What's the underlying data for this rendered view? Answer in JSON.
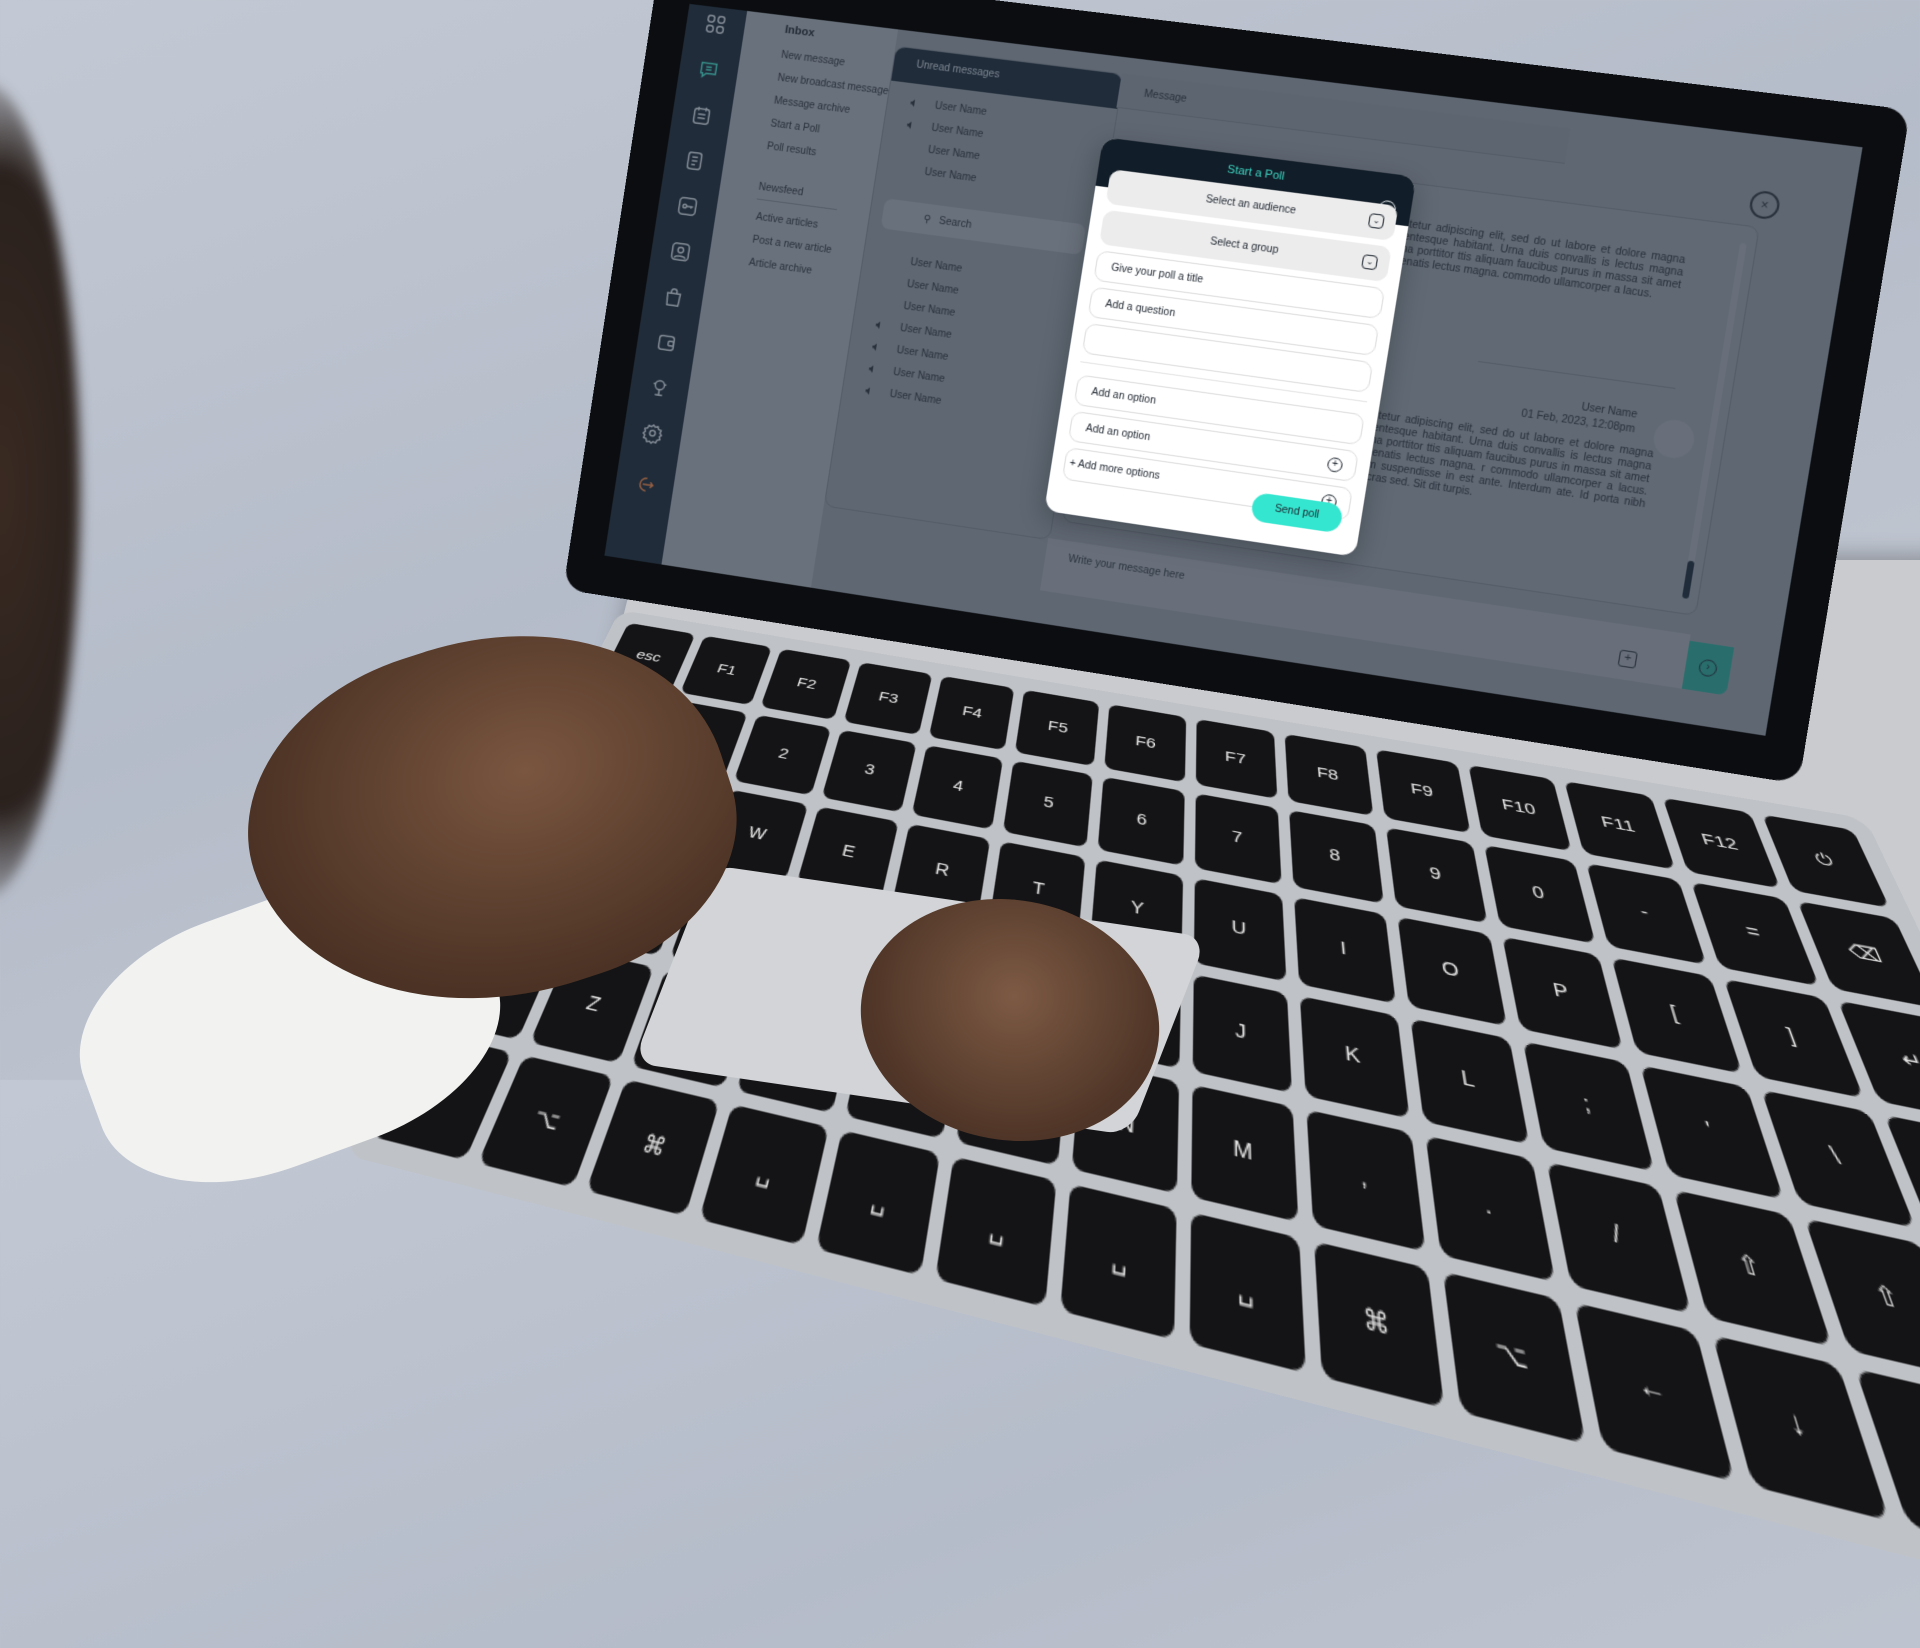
{
  "colors": {
    "rail_bg": "#1d2a3a",
    "accent_teal": "#3ec4b5",
    "send_button": "#34e6cf",
    "logout": "#d27a45",
    "modal_header": "#111d28"
  },
  "sidebar_icons": [
    {
      "name": "grid-icon"
    },
    {
      "name": "chat-icon",
      "active": true
    },
    {
      "name": "calendar-icon"
    },
    {
      "name": "document-icon"
    },
    {
      "name": "key-icon"
    },
    {
      "name": "user-icon"
    },
    {
      "name": "bag-icon"
    },
    {
      "name": "wallet-icon"
    },
    {
      "name": "trophy-icon"
    },
    {
      "name": "gear-icon"
    },
    {
      "name": "logout-icon"
    }
  ],
  "menu": {
    "inbox_heading": "Inbox",
    "inbox_items": [
      "New message",
      "New broadcast message",
      "Message archive",
      "Start a Poll",
      "Poll results"
    ],
    "newsfeed_heading": "Newsfeed",
    "newsfeed_items": [
      "Active articles",
      "Post a new article",
      "Article archive"
    ]
  },
  "list": {
    "tab_label": "Unread messages",
    "unread": [
      {
        "name": "User Name",
        "broadcast": true
      },
      {
        "name": "User Name",
        "broadcast": true
      },
      {
        "name": "User Name",
        "broadcast": false
      },
      {
        "name": "User Name",
        "broadcast": false
      }
    ],
    "search_placeholder": "Search",
    "users": [
      {
        "name": "User Name",
        "broadcast": false
      },
      {
        "name": "User Name",
        "broadcast": false
      },
      {
        "name": "User Name",
        "broadcast": false
      },
      {
        "name": "User Name",
        "broadcast": true
      },
      {
        "name": "User Name",
        "broadcast": true
      },
      {
        "name": "User Name",
        "broadcast": true
      },
      {
        "name": "User Name",
        "broadcast": true
      }
    ]
  },
  "message_panel": {
    "tab_label": "Message",
    "messages": [
      {
        "text": "et, consectetur adipiscing elit, sed do ut labore et dolore magna aliqua. ellentesque habitant. Urna duis convallis is lectus magna fringilla urna porttitor ttis aliquam faucibus purus in massa sit amet luctus venenatis lectus magna. commodo ullamcorper a lacus."
      },
      {
        "sender": "User Name",
        "timestamp": "01 Feb, 2023, 12:08pm",
        "text": "et, consectetur adipiscing elit, sed do ut labore et dolore magna aliqua. ellentesque habitant. Urna duis convallis is lectus magna fringilla urna porttitor ttis aliquam faucibus purus in massa sit amet luctus venenatis lectus magna. r commodo ullamcorper a lacus. Risus issim suspendisse in est ante. Interdum ate. Id porta nibh venenatis cras sed. Sit dit turpis."
      }
    ],
    "compose_placeholder": "Write your message here"
  },
  "modal": {
    "title": "Start a Poll",
    "audience_label": "Select an audience",
    "group_label": "Select a group",
    "title_placeholder": "Give your poll a title",
    "question_placeholder": "Add a question",
    "option1_placeholder": "Add an option",
    "option2_placeholder": "Add an option",
    "add_more_label": "+ Add more options",
    "send_label": "Send poll"
  }
}
